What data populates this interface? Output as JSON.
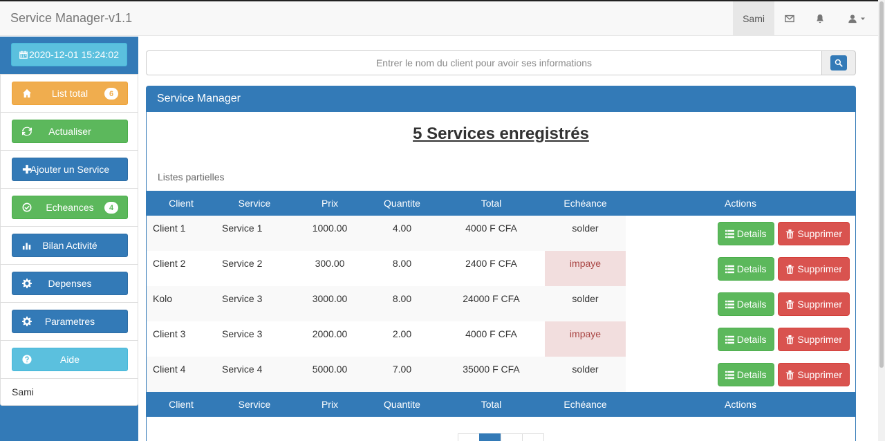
{
  "app": {
    "title": "Service Manager-v1.1"
  },
  "navbar": {
    "user": "Sami"
  },
  "sidebar": {
    "datetime": "2020-12-01 15:24:02",
    "items": [
      {
        "label": "List total",
        "badge": "6",
        "icon": "home-icon",
        "style": "warning"
      },
      {
        "label": "Actualiser",
        "icon": "refresh-icon",
        "style": "success"
      },
      {
        "label": "Ajouter un Service",
        "icon": "plus-icon",
        "style": "primary"
      },
      {
        "label": "Echeances",
        "badge": "4",
        "icon": "check-circle-icon",
        "style": "success"
      },
      {
        "label": "Bilan Activité",
        "icon": "bar-chart-icon",
        "style": "primary"
      },
      {
        "label": "Depenses",
        "icon": "gear-icon",
        "style": "primary"
      },
      {
        "label": "Parametres",
        "icon": "gear-icon",
        "style": "primary"
      },
      {
        "label": "Aide",
        "icon": "question-circle-icon",
        "style": "info"
      }
    ],
    "user": "Sami"
  },
  "search": {
    "placeholder": "Entrer le nom du client pour avoir ses informations"
  },
  "panel": {
    "heading": "Service Manager",
    "title": "5 Services enregistrés",
    "subtitle": "Listes partielles"
  },
  "table": {
    "columns": [
      "Client",
      "Service",
      "Prix",
      "Quantite",
      "Total",
      "Echéance",
      "Actions"
    ],
    "rows": [
      {
        "client": "Client 1",
        "service": "Service 1",
        "prix": "1000.00",
        "quantite": "4.00",
        "total": "4000 F CFA",
        "echeance": "solder"
      },
      {
        "client": "Client 2",
        "service": "Service 2",
        "prix": "300.00",
        "quantite": "8.00",
        "total": "2400 F CFA",
        "echeance": "impaye"
      },
      {
        "client": "Kolo",
        "service": "Service 3",
        "prix": "3000.00",
        "quantite": "8.00",
        "total": "24000 F CFA",
        "echeance": "solder"
      },
      {
        "client": "Client 3",
        "service": "Service 3",
        "prix": "2000.00",
        "quantite": "2.00",
        "total": "4000 F CFA",
        "echeance": "impaye"
      },
      {
        "client": "Client 4",
        "service": "Service 4",
        "prix": "5000.00",
        "quantite": "7.00",
        "total": "35000 F CFA",
        "echeance": "solder"
      }
    ],
    "details_label": "Details",
    "delete_label": "Supprimer"
  },
  "colors": {
    "primary": "#337ab7",
    "success": "#5cb85c",
    "warning": "#f0ad4e",
    "info": "#5bc0de",
    "danger": "#d9534f"
  }
}
